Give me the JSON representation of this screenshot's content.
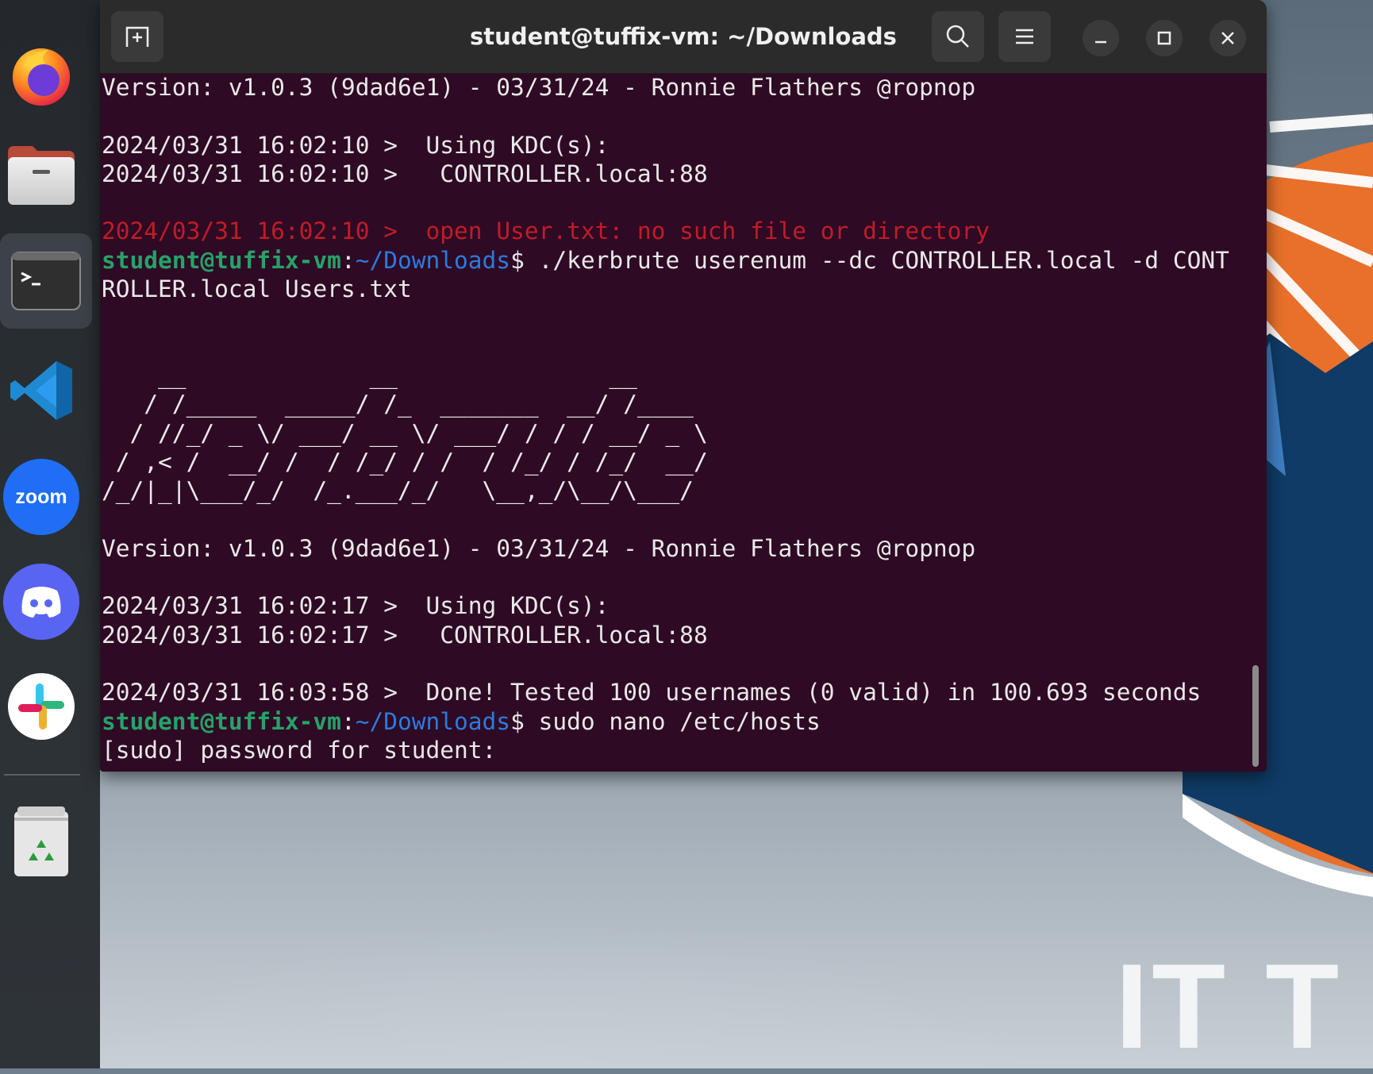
{
  "window": {
    "title": "student@tuffix-vm: ~/Downloads"
  },
  "dock": {
    "items": [
      {
        "name": "firefox-icon"
      },
      {
        "name": "files-icon"
      },
      {
        "name": "terminal-icon"
      },
      {
        "name": "vscode-icon"
      },
      {
        "name": "zoom-icon",
        "label": "zoom"
      },
      {
        "name": "discord-icon"
      },
      {
        "name": "slack-icon"
      },
      {
        "name": "trash-icon"
      }
    ]
  },
  "terminal": {
    "version_line_1": "Version: v1.0.3 (9dad6e1) - 03/31/24 - Ronnie Flathers @ropnop",
    "blank_1": "",
    "kdc_1a": "2024/03/31 16:02:10 >  Using KDC(s):",
    "kdc_1b": "2024/03/31 16:02:10 >   CONTROLLER.local:88",
    "blank_2": "",
    "error_line": "2024/03/31 16:02:10 >  open User.txt: no such file or directory",
    "prompt_user": "student@tuffix-vm",
    "prompt_colon": ":",
    "prompt_path": "~/Downloads",
    "prompt_dollar": "$",
    "command_1_part1": " ./kerbrute userenum --dc CONTROLLER.local -d CONT",
    "command_1_part2": "ROLLER.local Users.txt",
    "art": [
      "    __             __               __     ",
      "   / /_____  _____/ /_  _______  __/ /____ ",
      "  / //_/ _ \\/ ___/ __ \\/ ___/ / / / __/ _ \\",
      " / ,< /  __/ /  / /_/ / /  / /_/ / /_/  __/",
      "/_/|_|\\___/_/  /_.___/_/   \\__,_/\\__/\\___/ "
    ],
    "version_line_2": "Version: v1.0.3 (9dad6e1) - 03/31/24 - Ronnie Flathers @ropnop",
    "kdc_2a": "2024/03/31 16:02:17 >  Using KDC(s):",
    "kdc_2b": "2024/03/31 16:02:17 >   CONTROLLER.local:88",
    "done_line": "2024/03/31 16:03:58 >  Done! Tested 100 usernames (0 valid) in 100.693 seconds",
    "command_2": " sudo nano /etc/hosts",
    "sudo_prompt": "[sudo] password for student: "
  },
  "wallpaper": {
    "text": "IT T"
  }
}
